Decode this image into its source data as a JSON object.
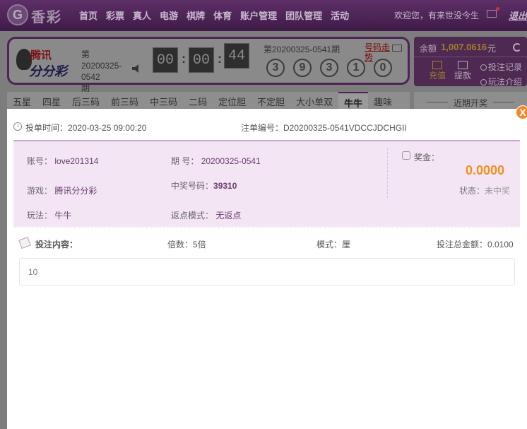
{
  "nav": {
    "logo_text": "香彩",
    "logo_glyph": "G",
    "items": [
      "首页",
      "彩票",
      "真人",
      "电游",
      "棋牌",
      "体育",
      "账户管理",
      "团队管理",
      "活动"
    ],
    "welcome": "欢迎您，有来世没今生",
    "logout": "退出"
  },
  "game": {
    "logo_line1": "腾讯",
    "logo_line2": "分分彩",
    "issue_prefix": "第",
    "issue_number": "20200325-0542",
    "issue_suffix": "期",
    "timer": [
      "00",
      "00",
      "44"
    ],
    "last_issue": "第20200325-0541期",
    "trend_link": "号码走势",
    "draw_balls": [
      "3",
      "9",
      "3",
      "1",
      "0"
    ]
  },
  "account": {
    "balance_label": "余额",
    "balance_value": "1,007.0616",
    "balance_unit": "元",
    "charge": "充值",
    "withdraw": "提款",
    "bet_record": "投注记录",
    "rules": "玩法介绍"
  },
  "tabs": {
    "items": [
      "五星",
      "四星",
      "后三码",
      "前三码",
      "中三码",
      "二码",
      "定位胆",
      "不定胆",
      "大小单双",
      "牛牛",
      "趣味"
    ],
    "active_index": 9,
    "recent_title": "近期开奖"
  },
  "modal": {
    "close": "X",
    "bet_time_label": "投单时间：",
    "bet_time": "2020-03-25 09:00:20",
    "order_label": "注单编号：",
    "order_number": "D20200325-0541VDCCJDCHGII",
    "account_label": "账号：",
    "account_value": "love201314",
    "period_label": "期 号：",
    "period_value": "20200325-0541",
    "game_label": "游戏：",
    "game_value": "腾讯分分彩",
    "winning_label": "中奖号码：",
    "winning_value": "39310",
    "play_label": "玩法：",
    "play_value": "牛牛",
    "rebate_label": "返点模式：",
    "rebate_value": "无返点",
    "prize_label": "奖金：",
    "prize_value": "0.0000",
    "status_label": "状态：",
    "status_value": "未中奖",
    "bet_content_label": "投注内容：",
    "multiple_label": "倍数：",
    "multiple_value": "5倍",
    "mode_label": "模式：",
    "mode_value": "厘",
    "total_label": "投注总金额：",
    "total_value": "0.0100",
    "bet_content": "10"
  },
  "colors": {
    "nav_bg": "#4b2355",
    "detail_bg": "#f3e5f4",
    "prize": "#f0901e",
    "close": "#f18a2e"
  }
}
